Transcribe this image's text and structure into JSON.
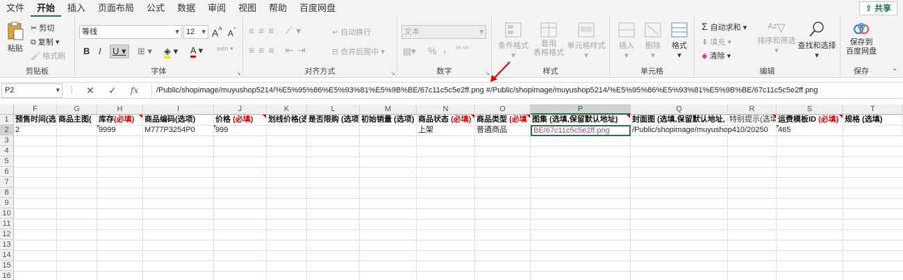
{
  "menu": {
    "items": [
      "文件",
      "开始",
      "插入",
      "页面布局",
      "公式",
      "数据",
      "审阅",
      "视图",
      "帮助",
      "百度网盘"
    ],
    "active_index": 1,
    "share": "共享"
  },
  "ribbon": {
    "clipboard": {
      "label": "剪贴板",
      "paste": "粘贴",
      "cut": "剪切",
      "copy": "复制",
      "format_painter": "格式刷"
    },
    "font": {
      "label": "字体",
      "name": "等线",
      "size": "12",
      "increase": "A",
      "decrease": "A",
      "bold": "B",
      "italic": "I",
      "underline": "U",
      "font_color_letter": "A",
      "phonetic": "wén"
    },
    "alignment": {
      "label": "对齐方式",
      "wrap": "自动换行",
      "merge": "合并后居中"
    },
    "number": {
      "label": "数字",
      "format": "文本",
      "percent": "%",
      "comma": ","
    },
    "styles": {
      "label": "样式",
      "conditional": "条件格式",
      "table": "套用\n表格格式",
      "cell_styles": "单元格样式"
    },
    "cells": {
      "label": "单元格",
      "insert": "插入",
      "delete": "删除",
      "format": "格式"
    },
    "editing": {
      "label": "编辑",
      "autosum": "自动求和",
      "fill": "填充",
      "clear": "清除",
      "sort": "排序和筛选",
      "find": "查找和选择"
    },
    "save": {
      "label": "保存",
      "button": "保存到\n百度网盘"
    }
  },
  "formula_bar": {
    "name_box": "P2",
    "fx": "fx",
    "content": "/Public/shopimage/muyushop5214/%E5%95%86%E5%93%81%E5%9B%BE/67c11c5c5e2ff.png #/Public/shopimage/muyushop5214/%E5%95%86%E5%93%81%E5%9B%BE/67c11c5c5e2ff.png"
  },
  "sheet": {
    "columns": [
      "F",
      "G",
      "H",
      "I",
      "J",
      "K",
      "L",
      "M",
      "N",
      "O",
      "P",
      "Q",
      "R",
      "S",
      "T"
    ],
    "selected_column": "P",
    "selected_row": "2",
    "rows": [
      "1",
      "2",
      "3",
      "4",
      "5",
      "6",
      "7",
      "8",
      "9",
      "10",
      "11",
      "12",
      "13",
      "14",
      "15",
      "16"
    ],
    "header_cells": [
      {
        "text": "预售时间(选",
        "req": ""
      },
      {
        "text": "商品主图(",
        "req": ""
      },
      {
        "text": "库存",
        "req": "(必填)"
      },
      {
        "text": "商品编码(选项)",
        "req": ""
      },
      {
        "text": "价格 ",
        "req": "(必填)"
      },
      {
        "text": "划线价格(选",
        "req": ""
      },
      {
        "text": "是否限购 (选项",
        "req": ""
      },
      {
        "text": "初始销量 (选项)",
        "req": ""
      },
      {
        "text": "商品状态 ",
        "req": "(必填)"
      },
      {
        "text": "商品类型 ",
        "req": "(必填"
      },
      {
        "text": "图集 (选填,保留默认地址)",
        "req": ""
      },
      {
        "text": "封面图 (选填,保留默认地址,",
        "req": ""
      },
      {
        "text": "特别提示(选填",
        "req": ""
      },
      {
        "text": "运费模板ID ",
        "req": "(必填)"
      },
      {
        "text": "规格 (选填)",
        "req": ""
      }
    ],
    "row2": [
      "2",
      "",
      "9999",
      "M777P3254P0",
      "999",
      "",
      "",
      "",
      "上架",
      "普通商品",
      "BE/67c11c5c5e2ff.png",
      "/Public/shopimage/muyushop410/20250",
      "",
      "465",
      ""
    ]
  }
}
